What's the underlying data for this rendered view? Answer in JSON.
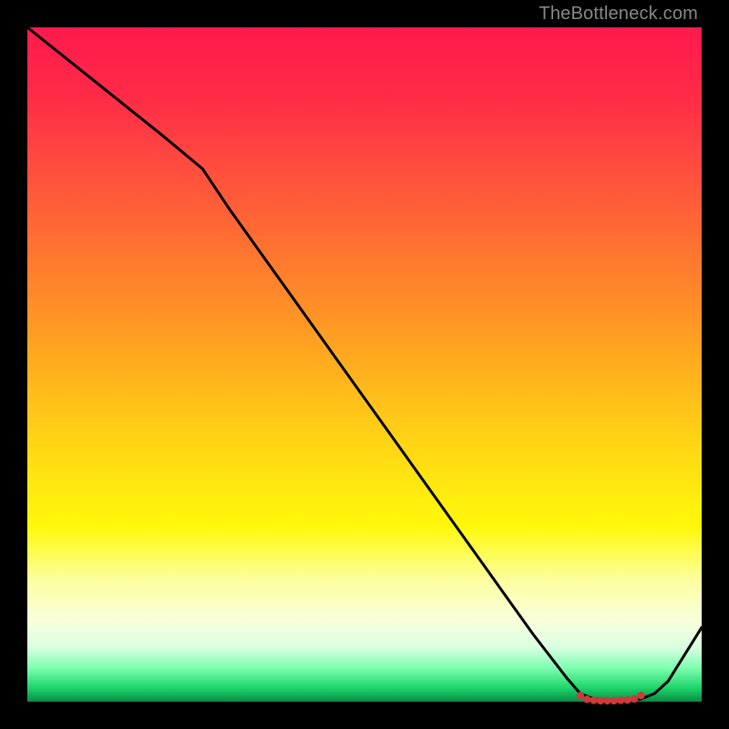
{
  "watermark": "TheBottleneck.com",
  "colors": {
    "line": "#000000",
    "marker": "#cc3a3a",
    "optimal": "#1cd46a"
  },
  "chart_data": {
    "type": "line",
    "title": "",
    "xlabel": "",
    "ylabel": "",
    "xlim": [
      0,
      100
    ],
    "ylim": [
      0,
      100
    ],
    "x": [
      0,
      5,
      10,
      15,
      20,
      26,
      30,
      35,
      40,
      45,
      50,
      55,
      60,
      65,
      70,
      75,
      80,
      82,
      84,
      86,
      88,
      89,
      91,
      93,
      95,
      100
    ],
    "y": [
      100,
      96,
      92,
      88,
      84,
      79,
      73,
      66,
      59,
      52,
      45,
      38,
      31,
      24,
      17,
      10,
      3.5,
      1.2,
      0.4,
      0.2,
      0.2,
      0.2,
      0.4,
      1.2,
      3,
      11
    ],
    "markers": {
      "x": [
        82,
        83,
        84,
        85,
        86,
        87,
        88,
        89,
        90,
        91
      ],
      "y": [
        0.9,
        0.35,
        0.2,
        0.15,
        0.15,
        0.15,
        0.2,
        0.25,
        0.4,
        0.9
      ]
    }
  }
}
